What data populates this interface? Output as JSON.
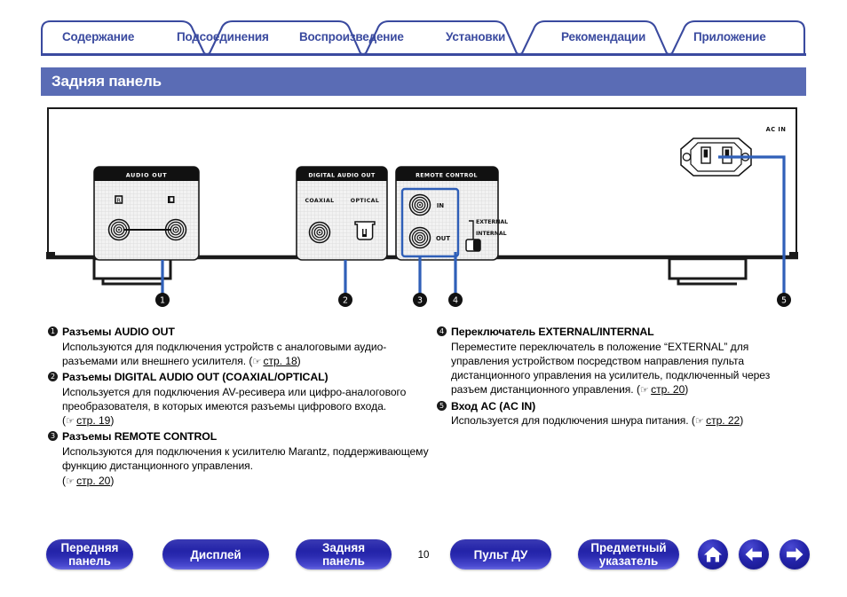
{
  "tabs": [
    {
      "label": "Содержание",
      "name": "tab-contents"
    },
    {
      "label": "Подсоединения",
      "name": "tab-connections"
    },
    {
      "label": "Воспроизведение",
      "name": "tab-playback"
    },
    {
      "label": "Установки",
      "name": "tab-settings"
    },
    {
      "label": "Рекомендации",
      "name": "tab-tips"
    },
    {
      "label": "Приложение",
      "name": "tab-appendix"
    }
  ],
  "section": {
    "title": "Задняя панель"
  },
  "illustration": {
    "labels": {
      "audio_out": "AUDIO OUT",
      "audio_out_r": "R",
      "audio_out_l": "L",
      "digital_audio_out": "DIGITAL AUDIO OUT",
      "coaxial": "COAXIAL",
      "optical": "OPTICAL",
      "remote_control": "REMOTE CONTROL",
      "remote_in": "IN",
      "remote_out": "OUT",
      "external": "EXTERNAL",
      "internal": "INTERNAL",
      "ac_in": "AC IN"
    },
    "callouts": [
      "1",
      "2",
      "3",
      "4",
      "5"
    ]
  },
  "descriptions": {
    "left": [
      {
        "num": "1",
        "heading": "Разъемы AUDIO OUT",
        "body": "Используются для подключения устройств с аналоговыми аудио-разъемами или внешнего усилителя.",
        "ref_prefix": "(",
        "ref_link": "стр. 18",
        "ref_suffix": ")"
      },
      {
        "num": "2",
        "heading": "Разъемы DIGITAL AUDIO OUT (COAXIAL/OPTICAL)",
        "body": "Используется для подключения AV-ресивера или цифро-аналогового преобразователя, в которых имеются разъемы цифрового входа.",
        "ref_prefix": "(",
        "ref_link": "стр. 19",
        "ref_suffix": ")"
      },
      {
        "num": "3",
        "heading": "Разъемы REMOTE CONTROL",
        "body": "Используются для подключения к усилителю Marantz, поддерживающему функцию дистанционного управления.",
        "ref_prefix": "(",
        "ref_link": "стр. 20",
        "ref_suffix": ")"
      }
    ],
    "right": [
      {
        "num": "4",
        "heading": "Переключатель EXTERNAL/INTERNAL",
        "body": "Переместите переключатель в положение “EXTERNAL” для управления устройством посредством направления пульта дистанционного управления на усилитель, подключенный через разъем дистанционного управления.",
        "ref_prefix": "(",
        "ref_link": "стр. 20",
        "ref_suffix": ")"
      },
      {
        "num": "5",
        "heading": "Вход AC (AC IN)",
        "body": "Используется для подключения шнура питания.",
        "ref_prefix": "(",
        "ref_link": "стр. 22",
        "ref_suffix": ")"
      }
    ]
  },
  "footer": {
    "buttons": [
      {
        "name": "footer-front-panel",
        "line1": "Передняя",
        "line2": "панель"
      },
      {
        "name": "footer-display",
        "line1": "Дисплей",
        "line2": ""
      },
      {
        "name": "footer-rear-panel",
        "line1": "Задняя",
        "line2": "панель"
      },
      {
        "name": "footer-remote",
        "line1": "Пульт ДУ",
        "line2": ""
      },
      {
        "name": "footer-index",
        "line1": "Предметный",
        "line2": "указатель"
      }
    ],
    "page_number": "10",
    "icons": [
      {
        "name": "home-icon",
        "label": "home"
      },
      {
        "name": "arrow-left-icon",
        "label": "previous"
      },
      {
        "name": "arrow-right-icon",
        "label": "next"
      }
    ]
  },
  "colors": {
    "tab_text": "#3a4a9f",
    "tab_outline": "#3a4a9f",
    "banner_bg": "#5a6cb5",
    "pill_bg": "#2323a8",
    "callout_line": "#2f5fb8",
    "highlight_box": "#2f5fb8"
  }
}
